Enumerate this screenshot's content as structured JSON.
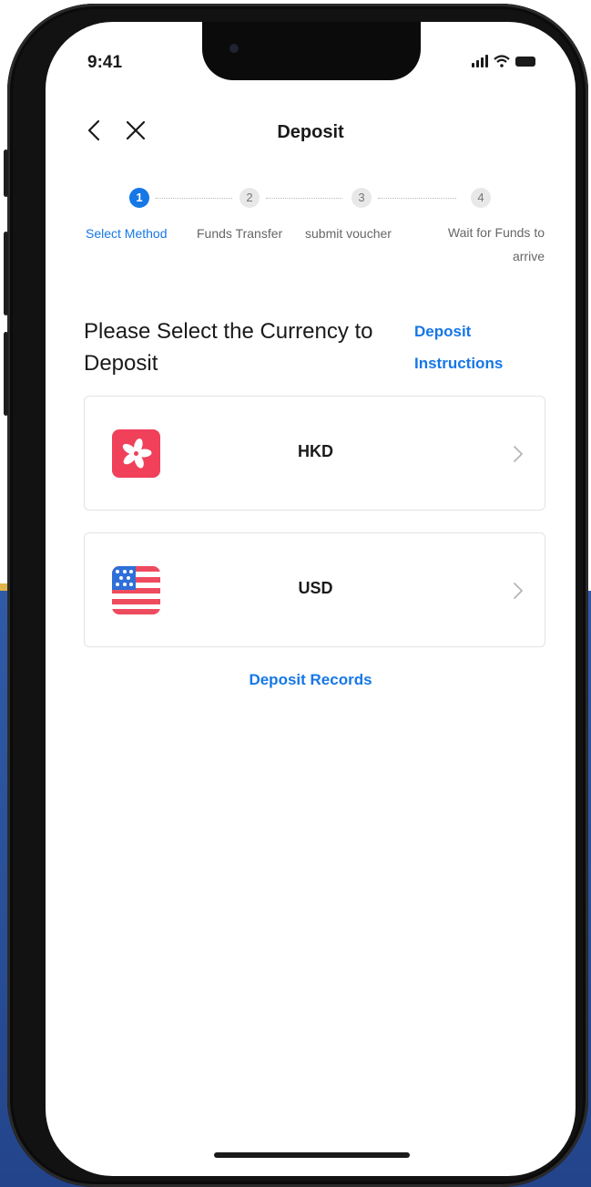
{
  "status_bar": {
    "time": "9:41"
  },
  "header": {
    "title": "Deposit"
  },
  "steps": [
    {
      "number": "1",
      "label": "Select Method",
      "active": true
    },
    {
      "number": "2",
      "label": "Funds Transfer",
      "active": false
    },
    {
      "number": "3",
      "label": "submit voucher",
      "active": false
    },
    {
      "number": "4",
      "label": "Wait for Funds to arrive",
      "active": false
    }
  ],
  "main": {
    "heading": "Please Select the Currency to Deposit",
    "instructions_link": "Deposit Instructions",
    "currencies": [
      {
        "code": "HKD",
        "flag_icon": "hong-kong-flag-icon"
      },
      {
        "code": "USD",
        "flag_icon": "us-flag-icon"
      }
    ],
    "records_link": "Deposit Records"
  },
  "colors": {
    "accent": "#1677e6",
    "hk_red": "#f0405a",
    "us_red": "#ef4b5f",
    "us_blue": "#2f6fd8",
    "backdrop_blue": "#2f5aa8"
  }
}
